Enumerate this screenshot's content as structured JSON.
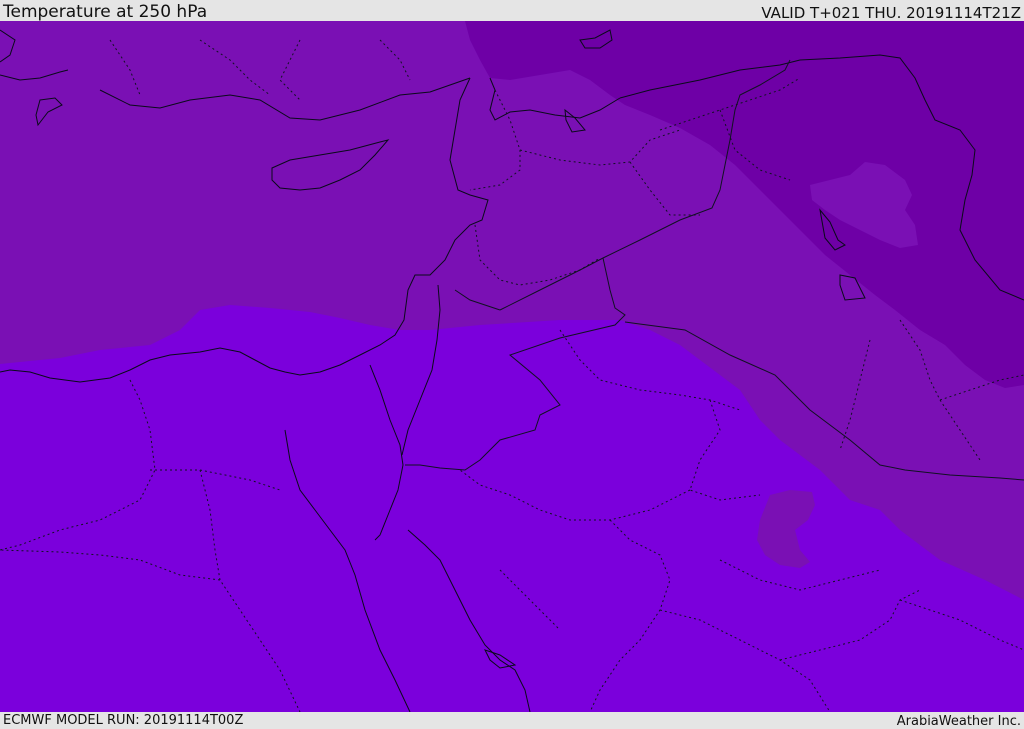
{
  "header": {
    "title": "Temperature at 250 hPa",
    "valid": "VALID T+021 THU. 20191114T21Z"
  },
  "footer": {
    "model_run": "ECMWF MODEL RUN: 20191114T00Z",
    "credit": "ArabiaWeather Inc."
  },
  "map": {
    "colors": {
      "warm_band": "#7b00dc",
      "mid_band": "#7a10b4",
      "cold_band": "#6e00a6",
      "cold_pocket": "#7a10b4",
      "coast_line": "#0a0a1a",
      "border_line": "#111122"
    }
  }
}
